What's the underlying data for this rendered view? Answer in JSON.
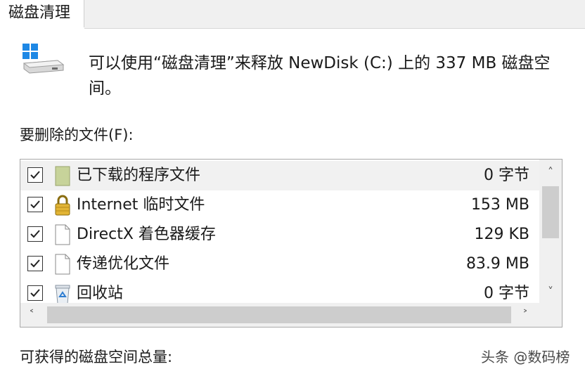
{
  "tab": {
    "label": "磁盘清理"
  },
  "description": "可以使用“磁盘清理”来释放 NewDisk (C:) 上的 337 MB 磁盘空间。",
  "files_label": "要删除的文件(F):",
  "files": [
    {
      "name": "已下载的程序文件",
      "size": "0 字节",
      "checked": true,
      "icon": "folder-icon",
      "selected": true
    },
    {
      "name": "Internet 临时文件",
      "size": "153 MB",
      "checked": true,
      "icon": "lock-icon",
      "selected": false
    },
    {
      "name": "DirectX 着色器缓存",
      "size": "129 KB",
      "checked": true,
      "icon": "document-icon",
      "selected": false
    },
    {
      "name": "传递优化文件",
      "size": "83.9 MB",
      "checked": true,
      "icon": "document-icon",
      "selected": false
    },
    {
      "name": "回收站",
      "size": "0 字节",
      "checked": true,
      "icon": "recycle-bin-icon",
      "selected": false
    }
  ],
  "total_label": "可获得的磁盘空间总量:",
  "watermark": "头条 @数码榜"
}
